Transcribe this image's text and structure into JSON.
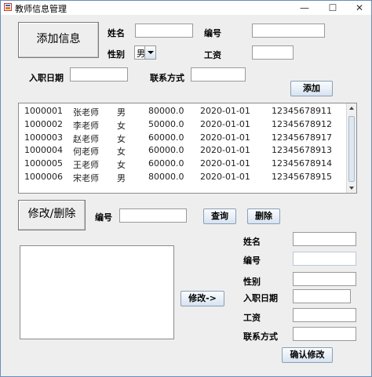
{
  "window": {
    "title": "教师信息管理",
    "minimize": "—",
    "maximize": "☐",
    "close": "✕"
  },
  "add_section": {
    "heading": "添加信息",
    "name_label": "姓名",
    "name_value": "",
    "id_label": "编号",
    "id_value": "",
    "gender_label": "性别",
    "gender_value": "男",
    "salary_label": "工资",
    "salary_value": "",
    "hire_date_label": "入职日期",
    "hire_date_value": "",
    "contact_label": "联系方式",
    "contact_value": "",
    "add_button": "添加"
  },
  "teacher_list": [
    {
      "id": "1000001",
      "name": "张老师",
      "gender": "男",
      "salary": "80000.0",
      "date": "2020-01-01",
      "phone": "12345678911"
    },
    {
      "id": "1000002",
      "name": "李老师",
      "gender": "女",
      "salary": "50000.0",
      "date": "2020-01-01",
      "phone": "12345678912"
    },
    {
      "id": "1000003",
      "name": "赵老师",
      "gender": "女",
      "salary": "60000.0",
      "date": "2020-01-01",
      "phone": "12345678917"
    },
    {
      "id": "1000004",
      "name": "何老师",
      "gender": "女",
      "salary": "60000.0",
      "date": "2020-01-01",
      "phone": "12345678913"
    },
    {
      "id": "1000005",
      "name": "王老师",
      "gender": "女",
      "salary": "60000.0",
      "date": "2020-01-01",
      "phone": "12345678914"
    },
    {
      "id": "1000006",
      "name": "宋老师",
      "gender": "男",
      "salary": "80000.0",
      "date": "2020-01-01",
      "phone": "12345678915"
    }
  ],
  "edit_section": {
    "heading": "修改/删除",
    "id_label": "编号",
    "id_value": "",
    "query_button": "查询",
    "delete_button": "删除",
    "modify_button": "修改->",
    "result_text": "",
    "name_label": "姓名",
    "name_value": "",
    "id2_label": "编号",
    "id2_value": "",
    "gender_label": "性别",
    "gender_value": "",
    "hire_date_label": "入职日期",
    "hire_date_value": "",
    "salary_label": "工资",
    "salary_value": "",
    "contact_label": "联系方式",
    "contact_value": "",
    "confirm_button": "确认修改"
  },
  "colors": {
    "window_border": "#6b8eb8",
    "button_gradient_top": "#fafcfe",
    "button_gradient_bottom": "#d7e3f0",
    "background": "#eeeeee"
  }
}
